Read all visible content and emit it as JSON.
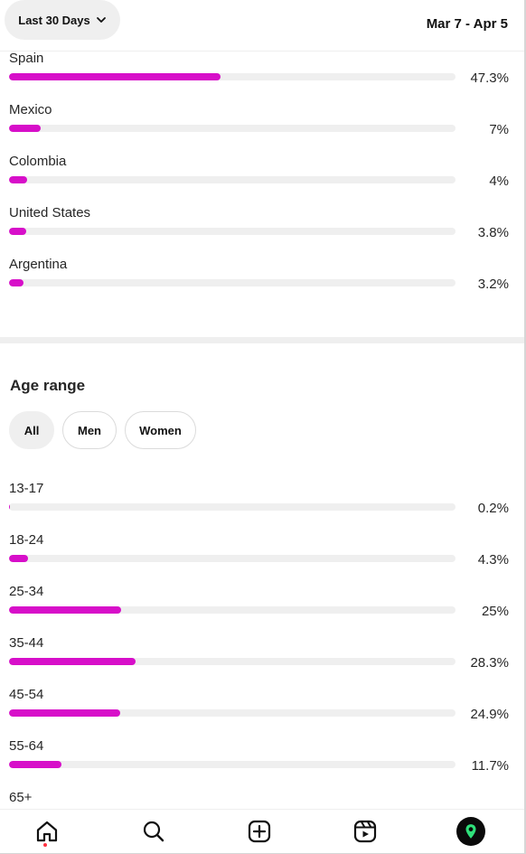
{
  "header": {
    "range_label": "Last 30 Days",
    "date_range": "Mar 7 - Apr 5"
  },
  "locations": [
    {
      "label": "Spain",
      "percent_text": "47.3%",
      "value": 47.3
    },
    {
      "label": "Mexico",
      "percent_text": "7%",
      "value": 7
    },
    {
      "label": "Colombia",
      "percent_text": "4%",
      "value": 4
    },
    {
      "label": "United States",
      "percent_text": "3.8%",
      "value": 3.8
    },
    {
      "label": "Argentina",
      "percent_text": "3.2%",
      "value": 3.2
    }
  ],
  "age_range": {
    "title": "Age range",
    "filters": [
      "All",
      "Men",
      "Women"
    ],
    "selected_filter": "All",
    "rows": [
      {
        "label": "13-17",
        "percent_text": "0.2%",
        "value": 0.2
      },
      {
        "label": "18-24",
        "percent_text": "4.3%",
        "value": 4.3
      },
      {
        "label": "25-34",
        "percent_text": "25%",
        "value": 25
      },
      {
        "label": "35-44",
        "percent_text": "28.3%",
        "value": 28.3
      },
      {
        "label": "45-54",
        "percent_text": "24.9%",
        "value": 24.9
      },
      {
        "label": "55-64",
        "percent_text": "11.7%",
        "value": 11.7
      },
      {
        "label": "65+",
        "percent_text": "",
        "value": null
      }
    ]
  },
  "bar_color": "#d70fc9",
  "notification_dot_color": "#ff3040",
  "nav": {
    "items": [
      "home-icon",
      "search-icon",
      "create-icon",
      "reels-icon",
      "profile-avatar"
    ],
    "active": "home-icon"
  }
}
